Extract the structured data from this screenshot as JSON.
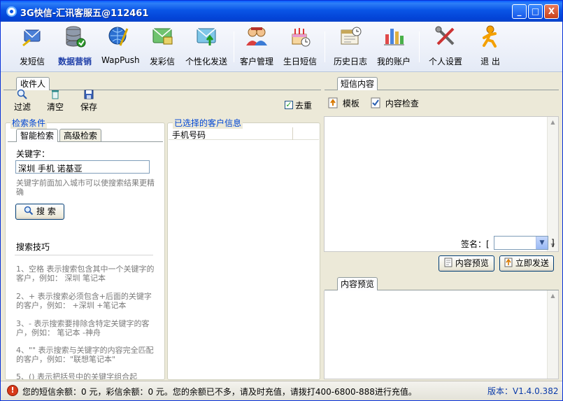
{
  "window": {
    "title": "3G快信-汇讯客服五@112461",
    "minimize": "_",
    "maximize": "□",
    "close": "X"
  },
  "toolbar": {
    "items": [
      {
        "label": "发短信",
        "icon": "send-sms-icon"
      },
      {
        "label": "数据营销",
        "icon": "database-icon",
        "active": true
      },
      {
        "label": "WapPush",
        "icon": "wap-push-icon"
      },
      {
        "label": "发彩信",
        "icon": "mms-icon"
      },
      {
        "label": "个性化发送",
        "icon": "personal-send-icon"
      },
      {
        "label": "客户管理",
        "icon": "customers-icon"
      },
      {
        "label": "生日短信",
        "icon": "birthday-cake-icon"
      },
      {
        "label": "历史日志",
        "icon": "history-log-icon"
      },
      {
        "label": "我的账户",
        "icon": "account-chart-icon"
      },
      {
        "label": "个人设置",
        "icon": "tools-settings-icon"
      },
      {
        "label": "退 出",
        "icon": "exit-icon"
      }
    ]
  },
  "recipients": {
    "tab_label": "收件人",
    "actions": [
      {
        "label": "过滤",
        "icon": "search-filter-icon"
      },
      {
        "label": "清空",
        "icon": "trash-icon"
      },
      {
        "label": "保存",
        "icon": "save-icon"
      }
    ],
    "dedupe_label": "去重",
    "dedupe_checked": true
  },
  "search_conditions": {
    "legend": "检索条件",
    "tabs": [
      "智能检索",
      "高级检索"
    ],
    "active_tab": 0,
    "keyword_label": "关键字：",
    "keyword_value": "深圳 手机 诺基亚",
    "keyword_hint": "关键字前面加入城市可以使搜索结果更精确",
    "search_button": "搜 索",
    "tips_title": "搜索技巧",
    "tips": [
      "1、空格 表示搜索包含其中一个关键字的客户，例如： 深圳 笔记本",
      "2、+ 表示搜索必须包含+后面的关键字的客户，例如： +深圳 +笔记本",
      "3、- 表示搜索要排除含特定关键字的客户，例如： 笔记本 -神舟",
      "4、\"\" 表示搜索与关键字的内容完全匹配的客户，例如：\"联想笔记本\"",
      "5、() 表示把括号中的关键字组合起"
    ]
  },
  "selected_customers": {
    "legend": "已选择的客户信息",
    "columns": [
      "手机号码",
      ""
    ]
  },
  "sms_content": {
    "tab_label": "短信内容",
    "template_label": "模板",
    "content_check_label": "内容检查",
    "signature_label": "签名：[",
    "signature_value": "",
    "signature_close": "]",
    "preview_button": "内容预览",
    "send_button": "立即发送",
    "preview_tab_label": "内容预览"
  },
  "status": {
    "message": "您的短信余额：0 元，彩信余额：0 元。您的余额已不多，请及时充值，请拨打400-6800-888进行充值。",
    "version": "版本：V1.4.0.382",
    "colors": {
      "version": "#0a3aa8",
      "warning_icon": "#d83a1a"
    }
  }
}
